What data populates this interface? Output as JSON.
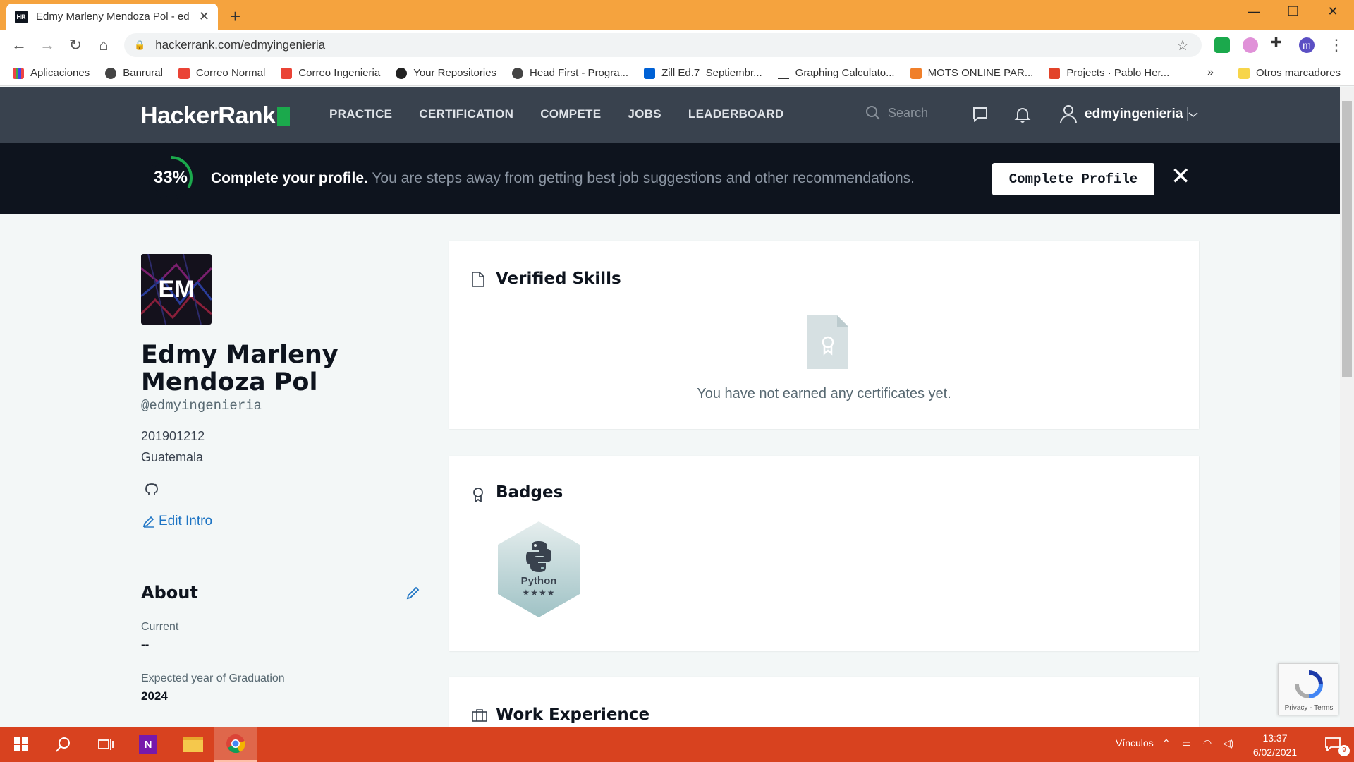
{
  "browser": {
    "tab_title": "Edmy Marleny Mendoza Pol - ed",
    "tab_favicon": "HR",
    "url": "hackerrank.com/edmyingenieria",
    "bookmarks": [
      "Aplicaciones",
      "Banrural",
      "Correo Normal",
      "Correo Ingenieria",
      "Your Repositories",
      "Head First - Progra...",
      "Zill Ed.7_Septiembr...",
      "Graphing Calculato...",
      "MOTS ONLINE PAR...",
      "Projects · Pablo Her..."
    ],
    "more_bookmarks": "»",
    "other_bookmarks": "Otros marcadores",
    "profile_initial": "m"
  },
  "hr_nav": {
    "logo": "HackerRank",
    "menu": [
      "PRACTICE",
      "CERTIFICATION",
      "COMPETE",
      "JOBS",
      "LEADERBOARD"
    ],
    "search_placeholder": "Search",
    "username": "edmyingenieria"
  },
  "banner": {
    "progress": "33%",
    "progress_fraction": 0.33,
    "headline": "Complete your profile.",
    "message": "You are steps away from getting best job suggestions and other recommendations.",
    "button": "Complete Profile"
  },
  "profile": {
    "avatar_initials": "EM",
    "name": "Edmy Marleny Mendoza Pol",
    "handle": "@edmyingenieria",
    "id_number": "201901212",
    "country": "Guatemala",
    "edit_intro": "Edit Intro",
    "about_title": "About",
    "current_label": "Current",
    "current_value": "--",
    "grad_label": "Expected year of Graduation",
    "grad_value": "2024"
  },
  "cards": {
    "verified_skills": "Verified Skills",
    "no_certificates": "You have not earned any certificates yet.",
    "badges": "Badges",
    "badge_name": "Python",
    "badge_stars": "★★★★",
    "work_experience": "Work Experience"
  },
  "recaptcha": "Privacy - Terms",
  "taskbar": {
    "vinculos": "Vínculos",
    "time": "13:37",
    "date": "6/02/2021",
    "notifications": "9"
  }
}
